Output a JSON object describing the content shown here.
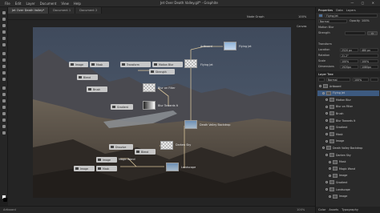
{
  "window": {
    "title": "Jet Over Death Valley.gif* - Graphite"
  },
  "menu": [
    "File",
    "Edit",
    "Layer",
    "Document",
    "View",
    "Help"
  ],
  "tabs": [
    {
      "label": "Jet Over Death Valley*",
      "active": true
    },
    {
      "label": "Document 1",
      "active": false
    },
    {
      "label": "Document 2",
      "active": false
    }
  ],
  "options": {
    "mode": "Node Graph",
    "view": "100%"
  },
  "graph": {
    "nodes": [
      {
        "id": "image1",
        "label": "Image"
      },
      {
        "id": "mask1",
        "label": "Mask"
      },
      {
        "id": "transform",
        "label": "Transform"
      },
      {
        "id": "motionblur",
        "label": "Motion Blur"
      },
      {
        "id": "blend1",
        "label": "Blend"
      },
      {
        "id": "strength",
        "label": "Strength"
      },
      {
        "id": "brush",
        "label": "Brush"
      },
      {
        "id": "gradient",
        "label": "Gradient"
      },
      {
        "id": "dissolve",
        "label": "Dissolve"
      },
      {
        "id": "blend2",
        "label": "Blend"
      },
      {
        "id": "image2",
        "label": "Image"
      },
      {
        "id": "mask2",
        "label": "Mask"
      },
      {
        "id": "image3",
        "label": "Image"
      }
    ],
    "labels": {
      "artboard": "Artboard",
      "flying_jet": "Flying Jet",
      "blur_filter": "Blur on Filter",
      "blur_towards": "Blur Towards It",
      "death_valley": "Death Valley Backdrop",
      "darken_sky": "Darken Sky",
      "magic_wand": "Magic Wand",
      "landscape": "Landscape",
      "canvas_label": "Canvas"
    }
  },
  "properties": {
    "tabs": [
      "Properties",
      "Data",
      "Layers"
    ],
    "active_tab": "Properties",
    "layer_name": "Flying Jet",
    "blend_mode": "Normal",
    "opacity_label": "Opacity",
    "opacity": "100%",
    "section_motion": "Motion Blur",
    "strength_label": "Strength",
    "section_transform": "Transform",
    "location_label": "Location",
    "location_x": "2520 px",
    "location_y": "480 px",
    "rotation_label": "Rotation",
    "rotation": "21.2°",
    "scale_label": "Scale",
    "scale_x": "100%",
    "scale_y": "100%",
    "dimensions_label": "Dimensions",
    "dim_w": "1920px",
    "dim_h": "1080px"
  },
  "layers_panel": {
    "tabs": [
      "Layer Tree"
    ],
    "blend": "Normal",
    "opacity": "100%",
    "items": [
      {
        "label": "Artboard",
        "indent": 0,
        "selected": false
      },
      {
        "label": "Flying Jet",
        "indent": 1,
        "selected": true
      },
      {
        "label": "Motion Blur",
        "indent": 2,
        "selected": false
      },
      {
        "label": "Blur on Filter",
        "indent": 2,
        "selected": false
      },
      {
        "label": "Brush",
        "indent": 2,
        "selected": false
      },
      {
        "label": "Blur Towards It",
        "indent": 2,
        "selected": false
      },
      {
        "label": "Gradient",
        "indent": 2,
        "selected": false
      },
      {
        "label": "Mask",
        "indent": 2,
        "selected": false
      },
      {
        "label": "Image",
        "indent": 2,
        "selected": false
      },
      {
        "label": "Death Valley Backdrop",
        "indent": 1,
        "selected": false
      },
      {
        "label": "Darken Sky",
        "indent": 2,
        "selected": false
      },
      {
        "label": "Mask",
        "indent": 3,
        "selected": false
      },
      {
        "label": "Magic Wand",
        "indent": 3,
        "selected": false
      },
      {
        "label": "Image",
        "indent": 3,
        "selected": false
      },
      {
        "label": "Gradient",
        "indent": 2,
        "selected": false
      },
      {
        "label": "Landscape",
        "indent": 2,
        "selected": false
      },
      {
        "label": "Image",
        "indent": 3,
        "selected": false
      }
    ],
    "bottom_tabs": [
      "Color",
      "Assets",
      "Typography"
    ]
  },
  "status": {
    "left": "Artboard",
    "right": "100%"
  },
  "colors": {
    "accent": "#3d5a80",
    "wire": "#d8c49a"
  }
}
